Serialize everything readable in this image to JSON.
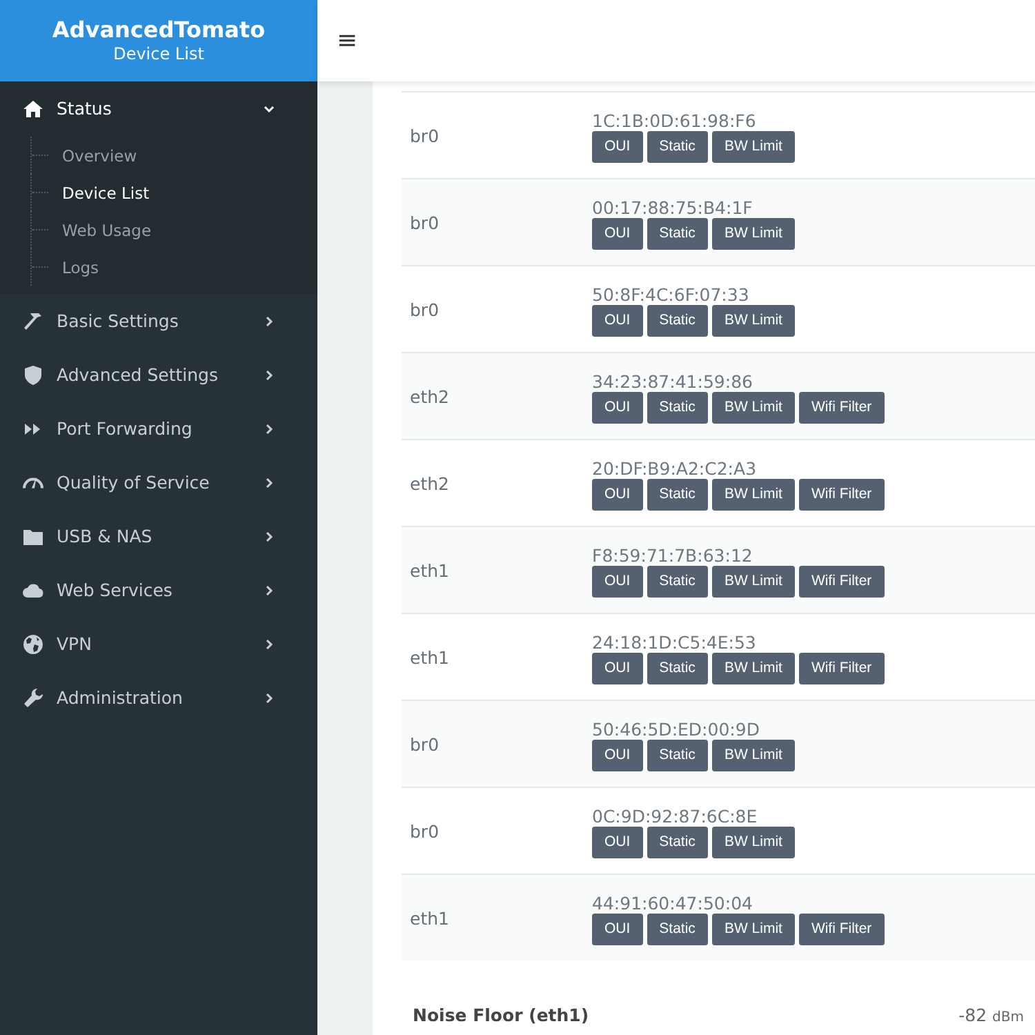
{
  "brand": {
    "title": "AdvancedTomato",
    "subtitle": "Device List"
  },
  "sidebar": {
    "items": [
      {
        "label": "Status",
        "expanded": true,
        "children": [
          {
            "label": "Overview",
            "selected": false
          },
          {
            "label": "Device List",
            "selected": true
          },
          {
            "label": "Web Usage",
            "selected": false
          },
          {
            "label": "Logs",
            "selected": false
          }
        ]
      },
      {
        "label": "Basic Settings",
        "expanded": false
      },
      {
        "label": "Advanced Settings",
        "expanded": false
      },
      {
        "label": "Port Forwarding",
        "expanded": false
      },
      {
        "label": "Quality of Service",
        "expanded": false
      },
      {
        "label": "USB & NAS",
        "expanded": false
      },
      {
        "label": "Web Services",
        "expanded": false
      },
      {
        "label": "VPN",
        "expanded": false
      },
      {
        "label": "Administration",
        "expanded": false
      }
    ]
  },
  "topbar": {
    "menu": "≡"
  },
  "table": {
    "rows": [
      {
        "interface": "br0",
        "mac": "1C:1B:0D:61:98:F6",
        "buttons": [
          "OUI",
          "Static",
          "BW Limit"
        ]
      },
      {
        "interface": "br0",
        "mac": "00:17:88:75:B4:1F",
        "buttons": [
          "OUI",
          "Static",
          "BW Limit"
        ]
      },
      {
        "interface": "br0",
        "mac": "50:8F:4C:6F:07:33",
        "buttons": [
          "OUI",
          "Static",
          "BW Limit"
        ]
      },
      {
        "interface": "eth2",
        "mac": "34:23:87:41:59:86",
        "buttons": [
          "OUI",
          "Static",
          "BW Limit",
          "Wifi Filter"
        ]
      },
      {
        "interface": "eth2",
        "mac": "20:DF:B9:A2:C2:A3",
        "buttons": [
          "OUI",
          "Static",
          "BW Limit",
          "Wifi Filter"
        ]
      },
      {
        "interface": "eth1",
        "mac": "F8:59:71:7B:63:12",
        "buttons": [
          "OUI",
          "Static",
          "BW Limit",
          "Wifi Filter"
        ]
      },
      {
        "interface": "eth1",
        "mac": "24:18:1D:C5:4E:53",
        "buttons": [
          "OUI",
          "Static",
          "BW Limit",
          "Wifi Filter"
        ]
      },
      {
        "interface": "br0",
        "mac": "50:46:5D:ED:00:9D",
        "buttons": [
          "OUI",
          "Static",
          "BW Limit"
        ]
      },
      {
        "interface": "br0",
        "mac": "0C:9D:92:87:6C:8E",
        "buttons": [
          "OUI",
          "Static",
          "BW Limit"
        ]
      },
      {
        "interface": "eth1",
        "mac": "44:91:60:47:50:04",
        "buttons": [
          "OUI",
          "Static",
          "BW Limit",
          "Wifi Filter"
        ]
      }
    ]
  },
  "noise_floor": {
    "label": "Noise Floor (eth1)",
    "value": "-82",
    "unit": "dBm"
  }
}
